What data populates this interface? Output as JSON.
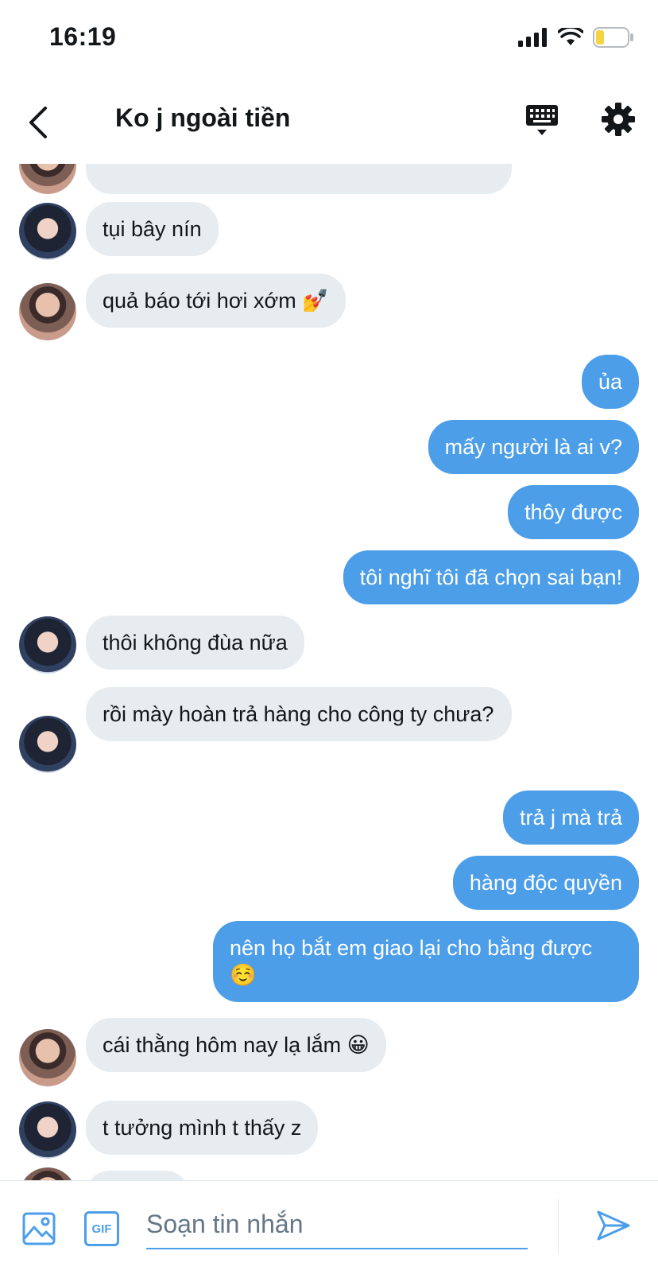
{
  "status_bar": {
    "time": "16:19",
    "battery_color": "#f5d342"
  },
  "header": {
    "title": "Ko j ngoài tiền",
    "back_icon": "chevron-left-icon",
    "keyboard_icon": "keyboard-icon",
    "settings_icon": "gear-icon"
  },
  "colors": {
    "accent": "#4c9ee8",
    "incoming_bubble": "#e6ecf0"
  },
  "messages": [
    {
      "side": "in",
      "text": "tụi bây nín",
      "avatar": "a"
    },
    {
      "side": "in",
      "text": "quả báo tới hơi xớm 💅",
      "avatar": "b"
    },
    {
      "side": "out",
      "text": "ủa"
    },
    {
      "side": "out",
      "text": "mấy người là ai v?"
    },
    {
      "side": "out",
      "text": "thôy được"
    },
    {
      "side": "out",
      "text": "tôi nghĩ tôi đã chọn sai bạn!"
    },
    {
      "side": "in",
      "text": "thôi không đùa nữa",
      "avatar": "a"
    },
    {
      "side": "in",
      "text": "rồi mày hoàn trả hàng cho công ty chưa?",
      "avatar": "a"
    },
    {
      "side": "out",
      "text": "trả j mà trả"
    },
    {
      "side": "out",
      "text": "hàng độc quyền"
    },
    {
      "side": "out",
      "text": "nên họ bắt em giao lại cho bằng được ☺️"
    },
    {
      "side": "in",
      "text": "cái thằng hôm nay lạ lắm 😀",
      "avatar": "b"
    },
    {
      "side": "in",
      "text": "t tưởng mình t thấy z",
      "avatar": "a"
    }
  ],
  "composer": {
    "placeholder": "Soạn tin nhắn",
    "value": "",
    "image_icon": "image-icon",
    "gif_label": "GIF",
    "send_icon": "send-icon"
  }
}
